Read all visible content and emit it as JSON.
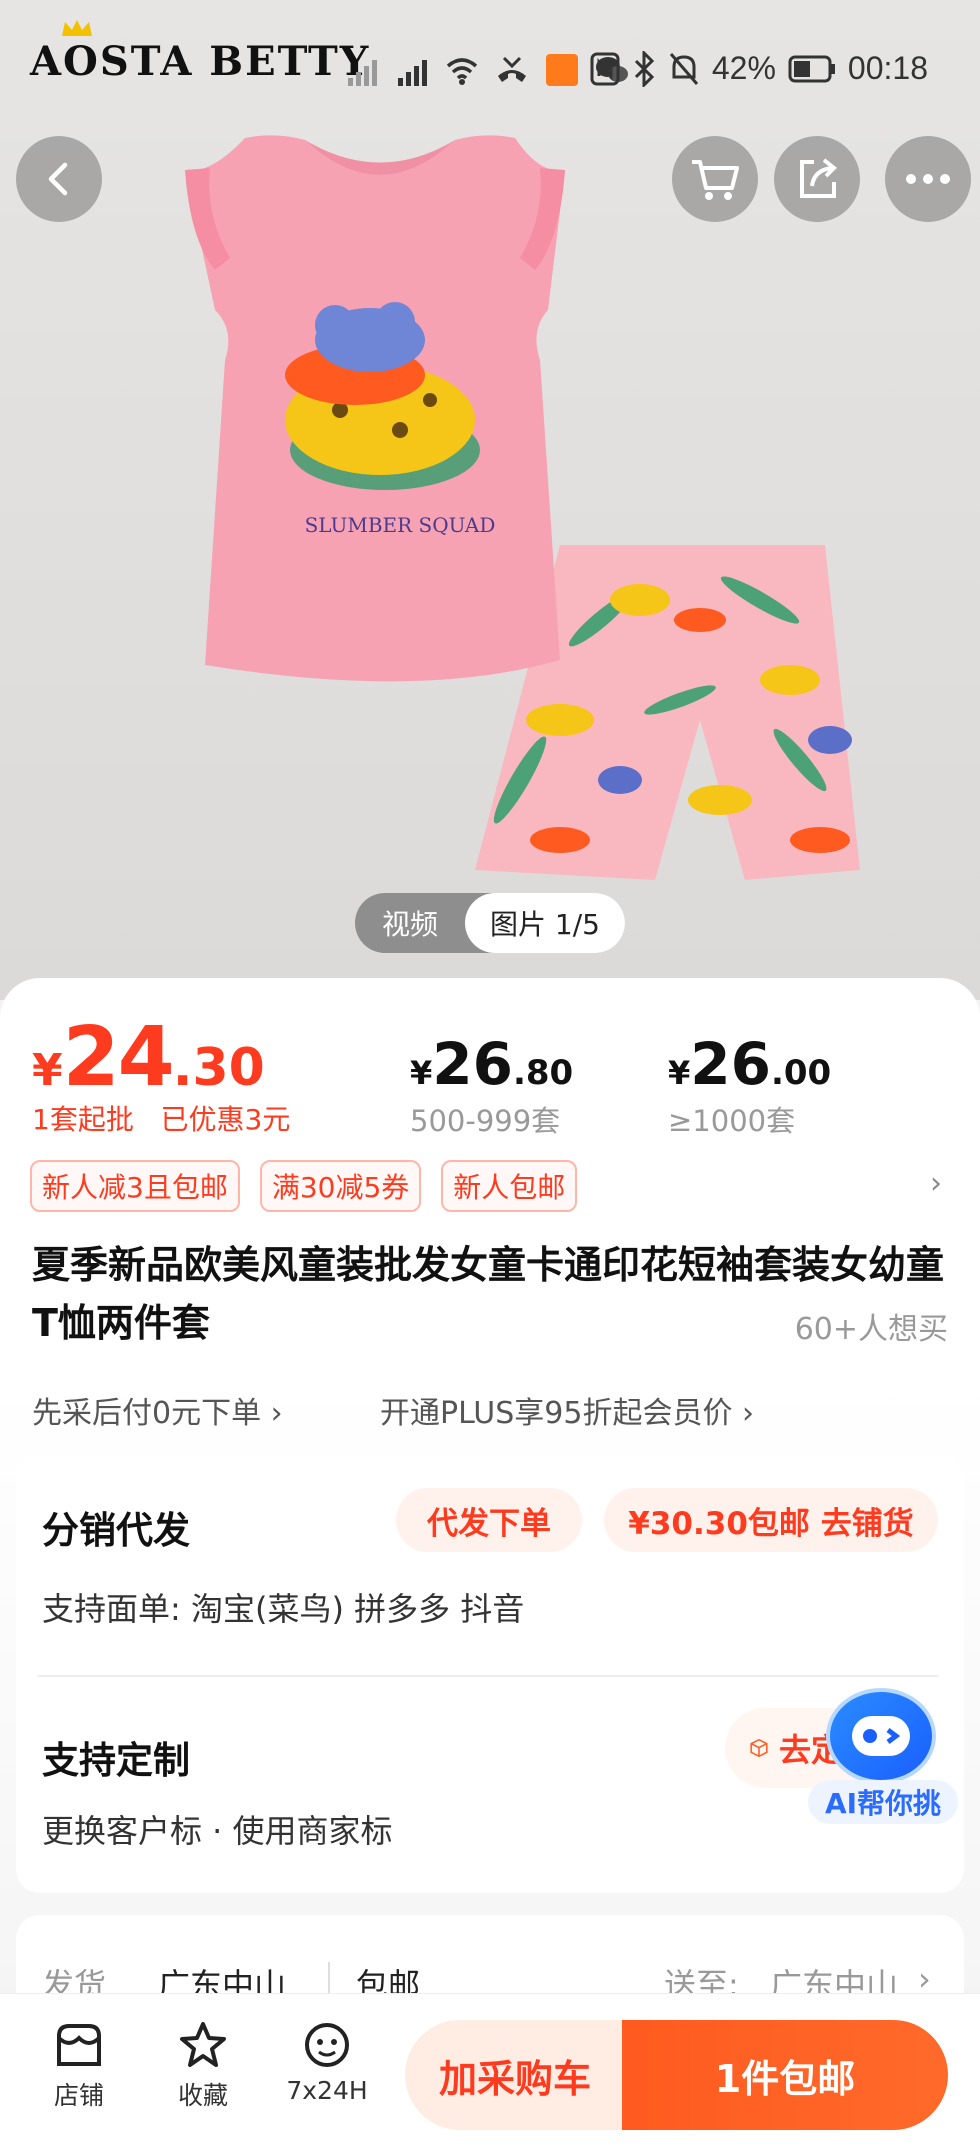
{
  "status_bar": {
    "brand": "AOSTA BETTY",
    "battery": "42%",
    "time": "00:18"
  },
  "media": {
    "video_label": "视频",
    "picture_label": "图片 1/5",
    "print_text": "SLUMBER SQUAD"
  },
  "price": {
    "yen": "¥",
    "main_int": "24",
    "main_dec": ".30",
    "min_order": "1套起批",
    "discount": "已优惠3元",
    "tiers": [
      {
        "yen": "¥",
        "int": "26",
        "dec": ".80",
        "qty": "500-999套"
      },
      {
        "yen": "¥",
        "int": "26",
        "dec": ".00",
        "qty": "≥1000套"
      }
    ]
  },
  "coupons": [
    "新人减3且包邮",
    "满30减5券",
    "新人包邮"
  ],
  "product": {
    "title": "夏季新品欧美风童装批发女童卡通印花短袖套装女幼童T恤两件套",
    "wants": "60+人想买"
  },
  "links": {
    "pay_later": "先采后付0元下单",
    "plus": "开通PLUS享95折起会员价"
  },
  "distribution": {
    "title": "分销代发",
    "order_btn": "代发下单",
    "shop_btn": "¥30.30包邮 去铺货",
    "support": "支持面单:  淘宝(菜鸟)  拼多多  抖音"
  },
  "custom": {
    "title": "支持定制",
    "options": "更换客户标  ·  使用商家标",
    "btn": "去定制"
  },
  "ai": {
    "label": "AI帮你挑"
  },
  "shipping": {
    "label": "发货",
    "origin": "广东中山",
    "free": "包邮",
    "to_label": "送至:",
    "dest": "广东中山"
  },
  "bottom_bar": {
    "shop": "店铺",
    "favorite": "收藏",
    "service": "7x24H",
    "add_cart": "加采购车",
    "buy": "1件包邮"
  },
  "colors": {
    "accent": "#ff3b1f",
    "buy_button": "#ff5a1f",
    "shirt": "#f7a2b3"
  }
}
